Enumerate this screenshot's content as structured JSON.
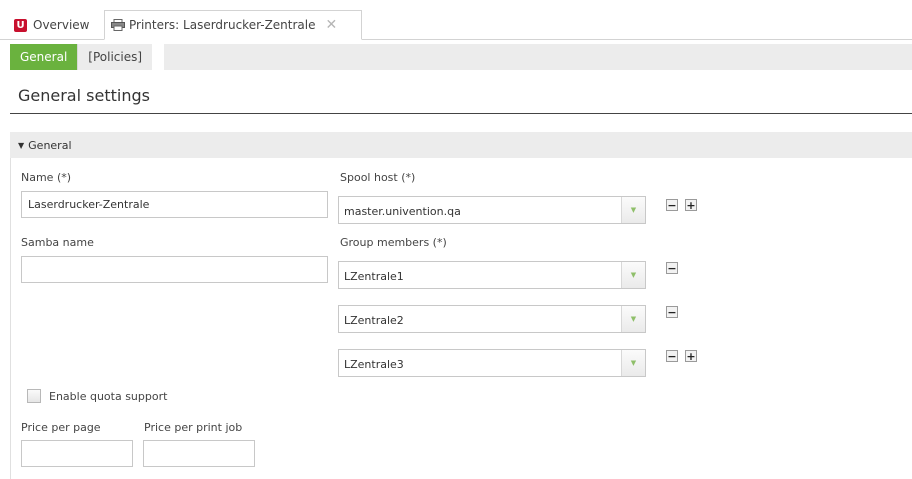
{
  "tabs": {
    "overview_label": "Overview",
    "printers_label": "Printers: Laserdrucker-Zentrale",
    "logo_letter": "U"
  },
  "subtabs": {
    "general": "General",
    "policies": "[Policies]"
  },
  "page_title": "General settings",
  "section": {
    "title": "General"
  },
  "form": {
    "name_label": "Name (*)",
    "name_value": "Laserdrucker-Zentrale",
    "samba_label": "Samba name",
    "samba_value": "",
    "spool_label": "Spool host (*)",
    "spool_value": "master.univention.qa",
    "group_label": "Group members (*)",
    "group_members": [
      "LZentrale1",
      "LZentrale2",
      "LZentrale3"
    ],
    "quota_label": "Enable quota support",
    "quota_checked": false,
    "price_page_label": "Price per page",
    "price_page_value": "",
    "price_job_label": "Price per print job",
    "price_job_value": ""
  },
  "colors": {
    "accent": "#6ab23e",
    "logo": "#c8102e"
  }
}
